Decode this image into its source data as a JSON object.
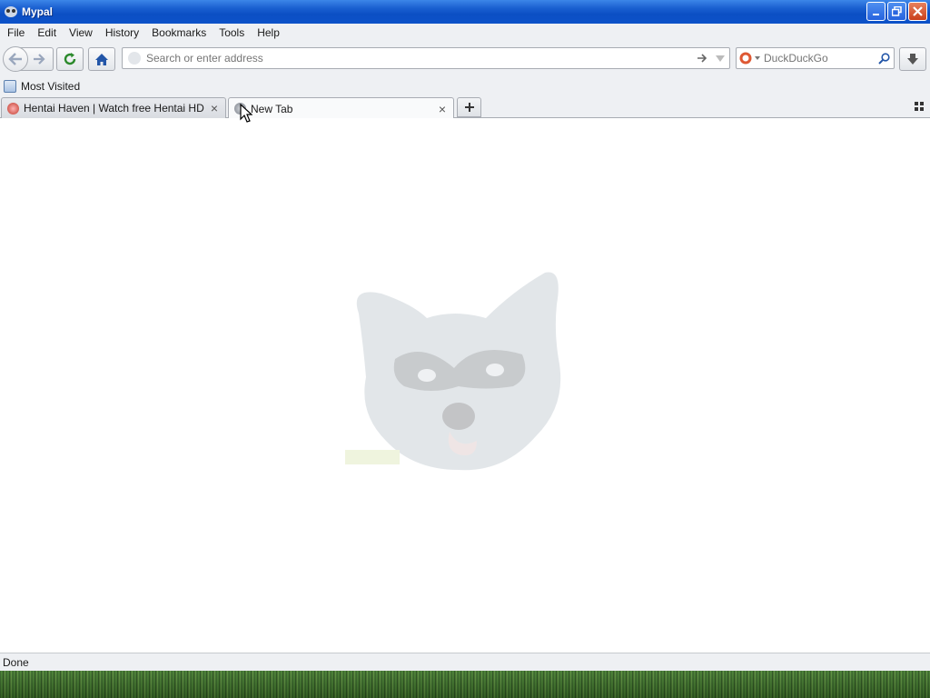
{
  "window": {
    "title": "Mypal"
  },
  "menubar": {
    "items": [
      {
        "label": "File"
      },
      {
        "label": "Edit"
      },
      {
        "label": "View"
      },
      {
        "label": "History"
      },
      {
        "label": "Bookmarks"
      },
      {
        "label": "Tools"
      },
      {
        "label": "Help"
      }
    ]
  },
  "navbar": {
    "url_placeholder": "Search or enter address",
    "url_value": "",
    "search_placeholder": "DuckDuckGo",
    "search_value": ""
  },
  "bookmarks": {
    "items": [
      {
        "label": "Most Visited",
        "icon": "bookmark-folder-icon"
      }
    ]
  },
  "tabs": [
    {
      "label": "Hentai Haven | Watch free Hentai HD",
      "active": false
    },
    {
      "label": "New Tab",
      "active": true
    }
  ],
  "content": {
    "background_image": "raccoon-face-watermark"
  },
  "status": {
    "text": "Done"
  },
  "colors": {
    "titlebar": "#0b4fc4",
    "chrome": "#eef0f3",
    "close_button": "#c9401c"
  }
}
